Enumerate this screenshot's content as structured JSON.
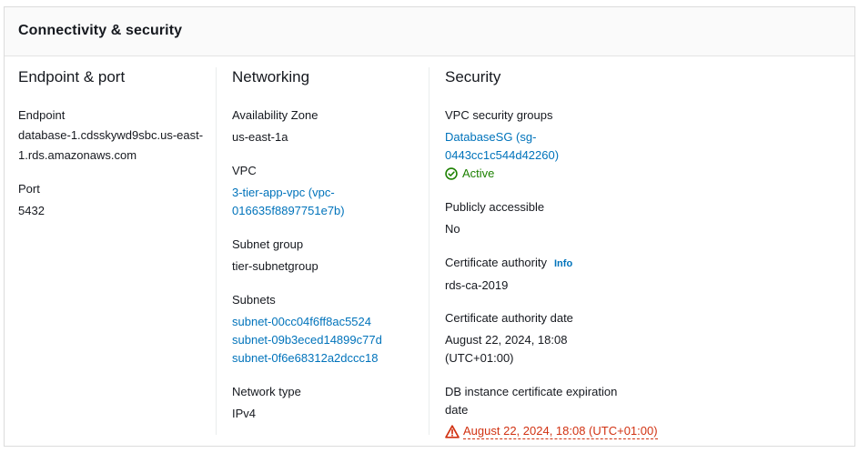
{
  "panel": {
    "title": "Connectivity & security"
  },
  "endpoint_port": {
    "title": "Endpoint & port",
    "endpoint_label": "Endpoint",
    "endpoint_line1": "database-1.cdsskywd9sbc.us-east-",
    "endpoint_line2": "1.rds.amazonaws.com",
    "port_label": "Port",
    "port_value": "5432"
  },
  "networking": {
    "title": "Networking",
    "az_label": "Availability Zone",
    "az_value": "us-east-1a",
    "vpc_label": "VPC",
    "vpc_line1": "3-tier-app-vpc (vpc-",
    "vpc_line2": "016635f8897751e7b)",
    "subnet_group_label": "Subnet group",
    "subnet_group_value": "tier-subnetgroup",
    "subnets_label": "Subnets",
    "subnets": [
      "subnet-00cc04f6ff8ac5524",
      "subnet-09b3eced14899c77d",
      "subnet-0f6e68312a2dccc18"
    ],
    "network_type_label": "Network type",
    "network_type_value": "IPv4"
  },
  "security": {
    "title": "Security",
    "sg_label": "VPC security groups",
    "sg_line1": "DatabaseSG (sg-",
    "sg_line2": "0443cc1c544d42260)",
    "sg_status": "Active",
    "public_label": "Publicly accessible",
    "public_value": "No",
    "ca_label": "Certificate authority",
    "ca_info": "Info",
    "ca_value": "rds-ca-2019",
    "ca_date_label": "Certificate authority date",
    "ca_date_line1": "August 22, 2024, 18:08",
    "ca_date_line2": "(UTC+01:00)",
    "expiry_label_line1": "DB instance certificate expiration",
    "expiry_label_line2": "date",
    "expiry_value": "August 22, 2024, 18:08 (UTC+01:00)"
  },
  "colors": {
    "link": "#0073bb",
    "success": "#1d8102",
    "error": "#d13212"
  }
}
